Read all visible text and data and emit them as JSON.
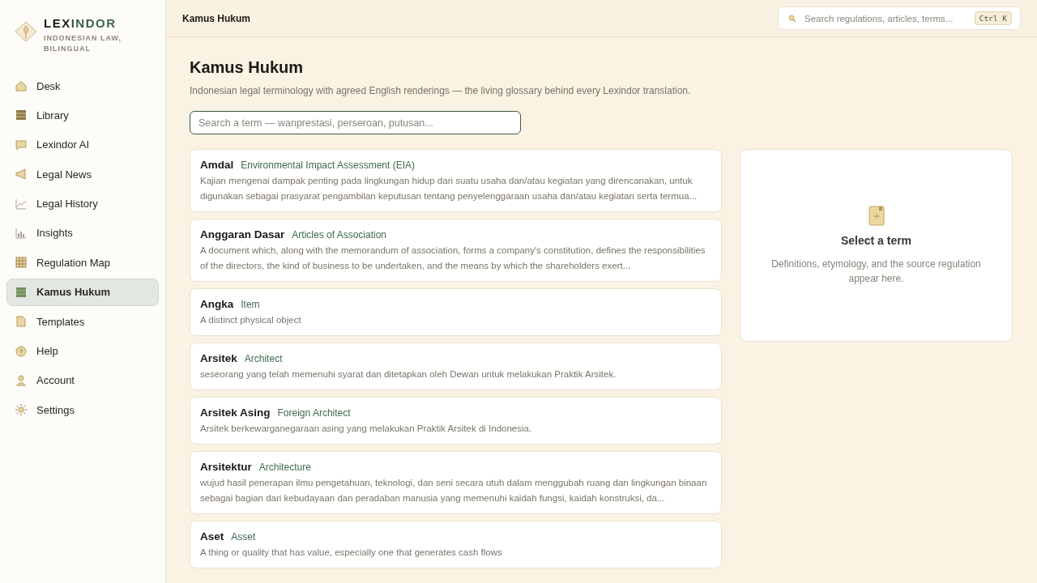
{
  "brand": {
    "name": "LEXINDOR",
    "tagline": "INDONESIAN LAW, BILINGUAL"
  },
  "nav": [
    {
      "label": "Desk",
      "selected": false
    },
    {
      "label": "Library",
      "selected": false
    },
    {
      "label": "Lexindor AI",
      "selected": false
    },
    {
      "label": "Legal News",
      "selected": false
    },
    {
      "label": "Legal History",
      "selected": false
    },
    {
      "label": "Insights",
      "selected": false
    },
    {
      "label": "Regulation Map",
      "selected": false
    },
    {
      "label": "Kamus Hukum",
      "selected": true
    },
    {
      "label": "Templates",
      "selected": false
    },
    {
      "label": "Help",
      "selected": false
    },
    {
      "label": "Account",
      "selected": false
    },
    {
      "label": "Settings",
      "selected": false
    }
  ],
  "topbar": {
    "title": "Kamus Hukum",
    "search": {
      "placeholder": "Search regulations, articles, terms...",
      "shortcut": "Ctrl K"
    }
  },
  "page": {
    "title": "Kamus Hukum",
    "subtitle": "Indonesian legal terminology with agreed English renderings — the living glossary behind every Lexindor translation.",
    "search": {
      "placeholder": "Search a term — wanprestasi, perseroan, putusan..."
    }
  },
  "terms": [
    {
      "term": "Amdal",
      "translation": "Environmental Impact Assessment (EIA)",
      "definition": "Kajian mengenai dampak penting pada lingkungan hidup dari suatu usaha dan/atau kegiatan yang direncanakan, untuk digunakan sebagai prasyarat pengambilan keputusan tentang penyelenggaraan usaha dan/atau kegiatan serta termua..."
    },
    {
      "term": "Anggaran Dasar",
      "translation": "Articles of Association",
      "definition": "A document which, along with the memorandum of association, forms a company's constitution, defines the responsibilities of the directors, the kind of business to be undertaken, and the means by which the shareholders exert..."
    },
    {
      "term": "Angka",
      "translation": "Item",
      "definition": "A distinct physical object"
    },
    {
      "term": "Arsitek",
      "translation": "Architect",
      "definition": "seseorang yang telah memenuhi syarat dan ditetapkan oleh Dewan untuk melakukan Praktik Arsitek."
    },
    {
      "term": "Arsitek Asing",
      "translation": "Foreign Architect",
      "definition": "Arsitek berkewarganegaraan asing yang melakukan Praktik Arsitek di Indonesia."
    },
    {
      "term": "Arsitektur",
      "translation": "Architecture",
      "definition": "wujud hasil penerapan ilmu pengetahuan, teknologi, dan seni secara utuh dalam menggubah ruang dan lingkungan binaan sebagai bagian dari kebudayaan dan peradaban manusia yang memenuhi kaidah fungsi, kaidah konstruksi, da..."
    },
    {
      "term": "Aset",
      "translation": "Asset",
      "definition": "A thing or quality that has value, especially one that generates cash flows"
    }
  ],
  "detail": {
    "title": "Select a term",
    "hint": "Definitions, etymology, and the source regulation appear here."
  }
}
